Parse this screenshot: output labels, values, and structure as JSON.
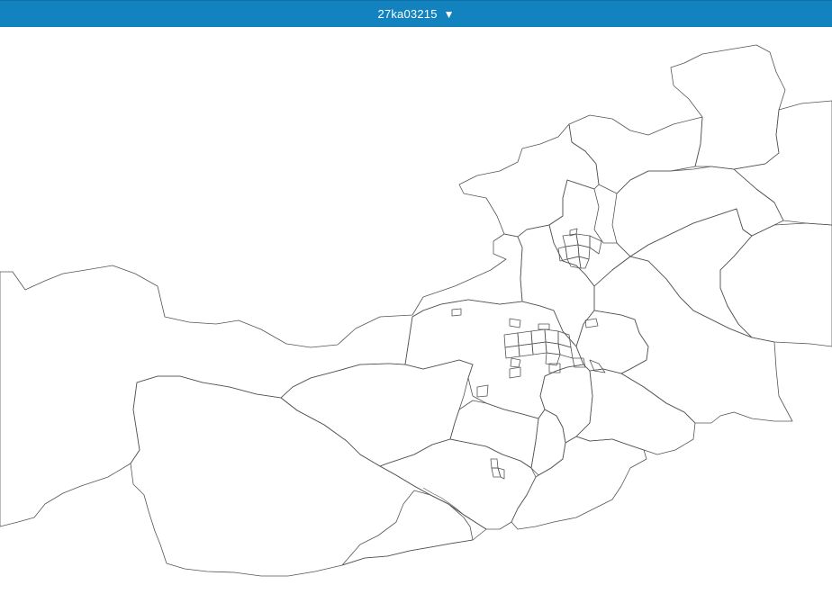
{
  "header": {
    "title": "27ka03215",
    "dropdown_icon": "triangle-down-icon",
    "accent_color": "#1283be",
    "text_color": "#ffffff"
  },
  "map": {
    "style": "outline-only",
    "stroke_color": "#555555",
    "fill_color": "#ffffff"
  }
}
